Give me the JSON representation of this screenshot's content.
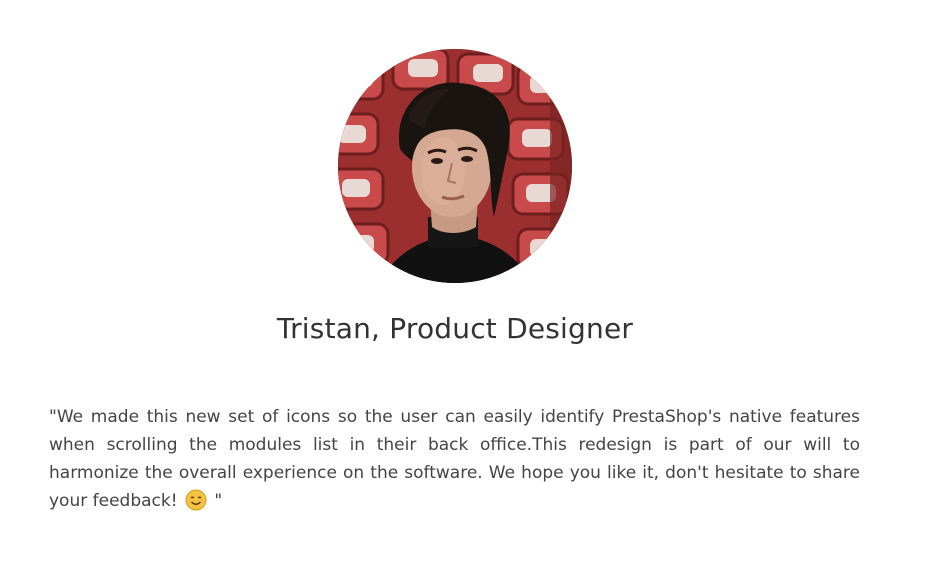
{
  "testimonial": {
    "author": "Tristan, Product Designer",
    "quote_text": "\"We made this new set of icons so the user can easily identify PrestaShop's native features when scrolling the modules list in their back office.This redesign is part of our will to harmonize the overall experience on the software. We hope you like it, don't hesitate to share your feedback!",
    "quote_end": " \"",
    "emoji": "smiling-face-emoji",
    "avatar": "author-photo"
  },
  "colors": {
    "text": "#444444",
    "heading": "#333333",
    "emoji_face": "#f5c242",
    "background": "#ffffff"
  }
}
